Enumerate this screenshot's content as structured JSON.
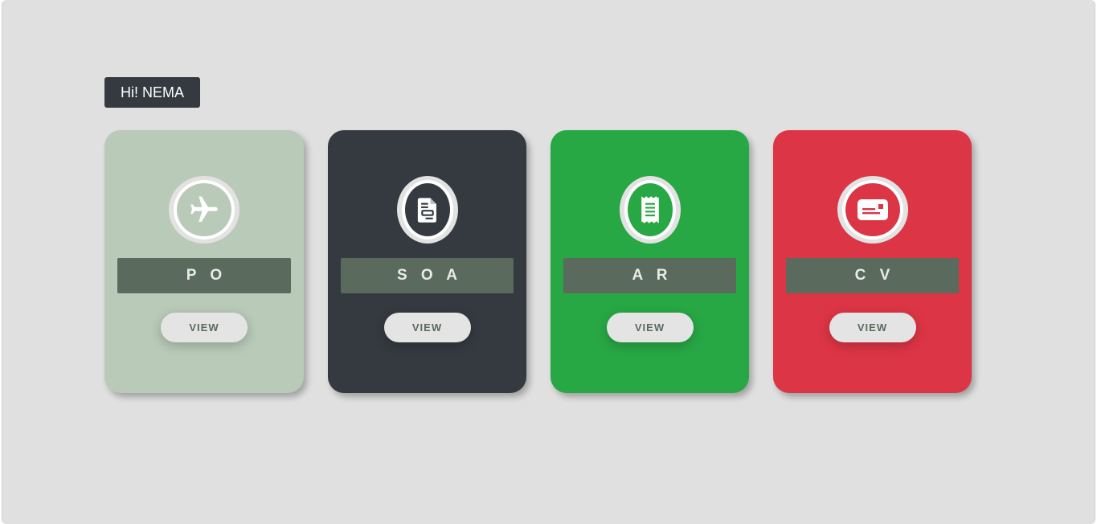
{
  "greeting": "Hi! NEMA",
  "cards": [
    {
      "label": "P O",
      "button": "VIEW",
      "icon": "airplane-icon",
      "color": "#b9cab9",
      "icon_bg": "#b9cab9"
    },
    {
      "label": "S O A",
      "button": "VIEW",
      "icon": "document-icon",
      "color": "#343a40",
      "icon_bg": "#343a40"
    },
    {
      "label": "A R",
      "button": "VIEW",
      "icon": "receipt-icon",
      "color": "#28a745",
      "icon_bg": "#28a745"
    },
    {
      "label": "C V",
      "button": "VIEW",
      "icon": "id-card-icon",
      "color": "#dc3545",
      "icon_bg": "#dc3545"
    }
  ]
}
